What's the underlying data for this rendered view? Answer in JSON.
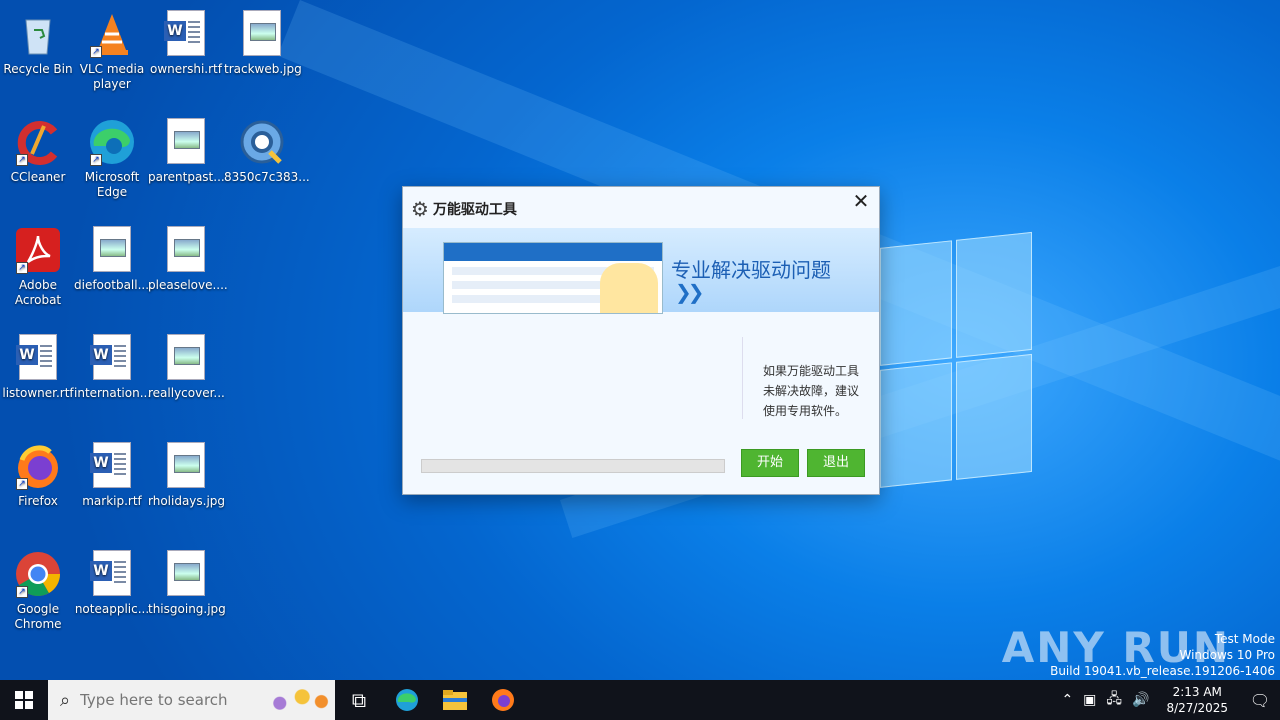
{
  "desktop": {
    "icons": [
      {
        "label": "Recycle Bin",
        "icon": "recycle-bin-icon"
      },
      {
        "label": "VLC media player",
        "icon": "vlc-icon"
      },
      {
        "label": "ownershi.rtf",
        "icon": "word-document-icon"
      },
      {
        "label": "trackweb.jpg",
        "icon": "image-file-icon"
      },
      {
        "label": "CCleaner",
        "icon": "ccleaner-icon"
      },
      {
        "label": "Microsoft Edge",
        "icon": "edge-icon"
      },
      {
        "label": "parentpast...",
        "icon": "image-file-icon"
      },
      {
        "label": "8350c7c383...",
        "icon": "setup-gear-icon"
      },
      {
        "label": "Adobe Acrobat",
        "icon": "acrobat-icon"
      },
      {
        "label": "diefootball....",
        "icon": "image-file-icon"
      },
      {
        "label": "pleaselove....",
        "icon": "image-file-icon"
      },
      {
        "label": "listowner.rtf",
        "icon": "word-document-icon"
      },
      {
        "label": "internation...",
        "icon": "word-document-icon"
      },
      {
        "label": "reallycover...",
        "icon": "image-file-icon"
      },
      {
        "label": "Firefox",
        "icon": "firefox-icon"
      },
      {
        "label": "markip.rtf",
        "icon": "word-document-icon"
      },
      {
        "label": "rholidays.jpg",
        "icon": "image-file-icon"
      },
      {
        "label": "Google Chrome",
        "icon": "chrome-icon"
      },
      {
        "label": "noteapplic...",
        "icon": "word-document-icon"
      },
      {
        "label": "thisgoing.jpg",
        "icon": "image-file-icon"
      }
    ]
  },
  "dialog": {
    "title": "万能驱动工具",
    "banner_text": "专业解决驱动问题",
    "hint": "如果万能驱动工具未解决故障，建议使用专用软件。",
    "start_label": "开始",
    "exit_label": "退出",
    "progress_value": 0
  },
  "watermark": "ANY RUN",
  "system_info": {
    "line1": "Test Mode",
    "line2": "Windows 10 Pro",
    "line3": "Build 19041.vb_release.191206-1406"
  },
  "taskbar": {
    "search_placeholder": "Type here to search",
    "time": "2:13 AM",
    "date": "8/27/2025"
  },
  "colors": {
    "accent_green": "#4fb531",
    "banner_blue": "#1c5fb4",
    "taskbar": "#10131b"
  }
}
